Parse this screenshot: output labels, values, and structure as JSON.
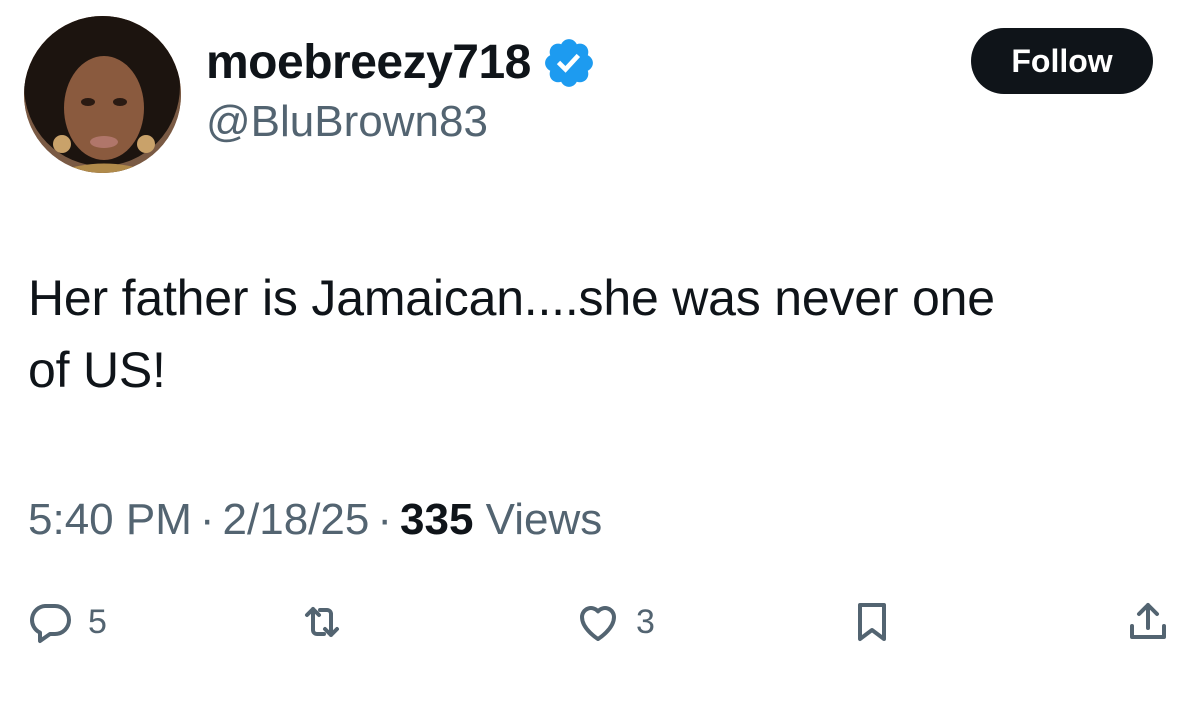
{
  "author": {
    "display_name": "moebreezy718",
    "handle": "@BluBrown83",
    "verified": true,
    "verified_color": "#1d9bf0"
  },
  "follow_button": {
    "label": "Follow"
  },
  "tweet": {
    "text_line1": "Her father is Jamaican....she was never one",
    "text_line2": "of US!"
  },
  "meta": {
    "time": "5:40 PM",
    "separator": "·",
    "date": "2/18/25",
    "views_count": "335",
    "views_label": "Views"
  },
  "actions": {
    "reply": {
      "icon": "reply-icon",
      "count": "5"
    },
    "retweet": {
      "icon": "retweet-icon"
    },
    "like": {
      "icon": "heart-icon",
      "count": "3"
    },
    "bookmark": {
      "icon": "bookmark-icon"
    },
    "share": {
      "icon": "share-icon"
    }
  },
  "colors": {
    "text_primary": "#0f1419",
    "text_secondary": "#536471",
    "button_bg": "#0f1419"
  }
}
